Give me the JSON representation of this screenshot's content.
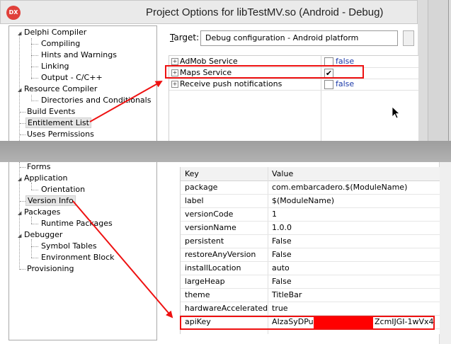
{
  "window": {
    "title": "Project Options for libTestMV.so  (Android - Debug)",
    "app_icon": "DX"
  },
  "target": {
    "label": "Target:",
    "value": "Debug configuration - Android platform"
  },
  "tree_top": [
    {
      "label": "Delphi Compiler",
      "expander": "◢"
    },
    {
      "label": "Compiling"
    },
    {
      "label": "Hints and Warnings"
    },
    {
      "label": "Linking"
    },
    {
      "label": "Output - C/C++"
    },
    {
      "label": "Resource Compiler",
      "expander": "◢"
    },
    {
      "label": "Directories and Conditionals"
    },
    {
      "label": "Build Events"
    },
    {
      "label": "Entitlement List"
    },
    {
      "label": "Uses Permissions"
    }
  ],
  "entitlements": [
    {
      "name": "AdMob Service",
      "value": "false",
      "checked": false
    },
    {
      "name": "Maps Service",
      "value": "",
      "checked": true
    },
    {
      "name": "Receive push notifications",
      "value": "false",
      "checked": false
    }
  ],
  "tree_bottom": [
    {
      "label": "Forms"
    },
    {
      "label": "Application",
      "expander": "◢"
    },
    {
      "label": "Orientation"
    },
    {
      "label": "Version Info"
    },
    {
      "label": "Packages",
      "expander": "◢"
    },
    {
      "label": "Runtime Packages"
    },
    {
      "label": "Debugger",
      "expander": "◢"
    },
    {
      "label": "Symbol Tables"
    },
    {
      "label": "Environment Block"
    },
    {
      "label": "Provisioning"
    }
  ],
  "version_grid": {
    "headers": {
      "key": "Key",
      "value": "Value"
    },
    "rows": [
      {
        "key": "package",
        "value": "com.embarcadero.$(ModuleName)"
      },
      {
        "key": "label",
        "value": "$(ModuleName)"
      },
      {
        "key": "versionCode",
        "value": "1"
      },
      {
        "key": "versionName",
        "value": "1.0.0"
      },
      {
        "key": "persistent",
        "value": "False"
      },
      {
        "key": "restoreAnyVersion",
        "value": "False"
      },
      {
        "key": "installLocation",
        "value": "auto"
      },
      {
        "key": "largeHeap",
        "value": "False"
      },
      {
        "key": "theme",
        "value": "TitleBar"
      },
      {
        "key": "hardwareAccelerated",
        "value": "true"
      },
      {
        "key": "apiKey",
        "value_left": "AIzaSyDPu3L",
        "value_right": "ZcmIJGI-1wVx4"
      }
    ]
  },
  "colors": {
    "annotation": "#ee1111",
    "link_blue": "#1c3aa9",
    "redaction": "#ff0000"
  }
}
